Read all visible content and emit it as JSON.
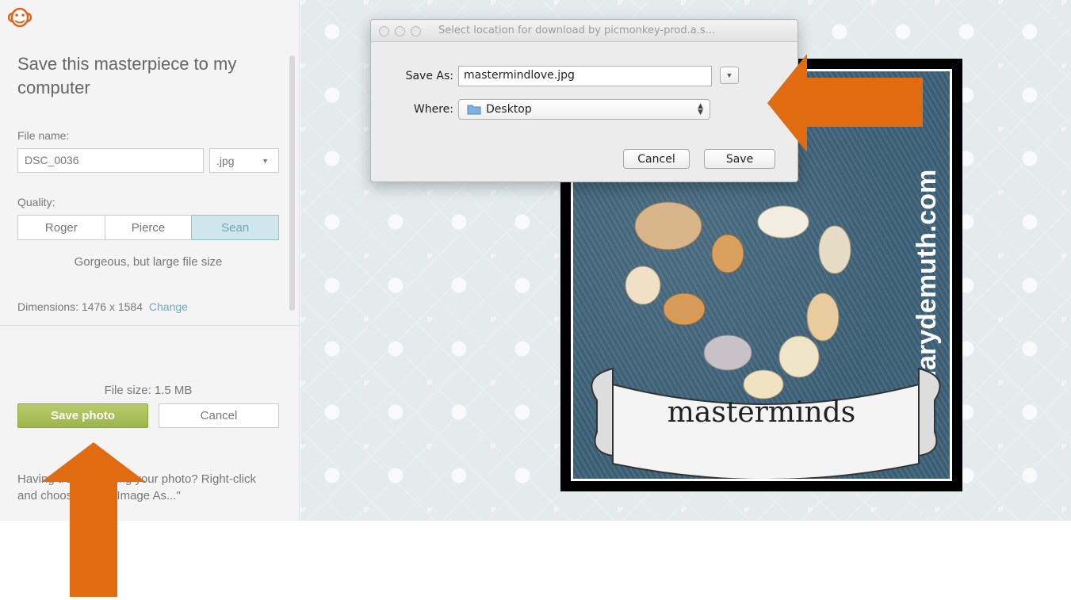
{
  "left_panel": {
    "logo_icon": "monkey-icon",
    "title": "Save this masterpiece to my computer",
    "file_name_label": "File name:",
    "file_name_value": "DSC_0036",
    "extension_value": ".jpg",
    "quality_label": "Quality:",
    "quality_options": [
      "Roger",
      "Pierce",
      "Sean"
    ],
    "quality_selected": "Sean",
    "quality_description": "Gorgeous, but large file size",
    "dimensions_label": "Dimensions:",
    "dimensions_value": "1476 x 1584",
    "change_link": "Change",
    "file_size": "File size: 1.5 MB",
    "save_button": "Save photo",
    "cancel_button": "Cancel",
    "help_text": "Having trouble saving your photo? Right-click and choose \"Save Image As...\"",
    "colors": {
      "save_green": "#a7bd55",
      "active_quality": "#cfe7ec",
      "link_blue": "#6aaec2"
    }
  },
  "dialog": {
    "title": "Select location for download by picmonkey-prod.a.s...",
    "save_as_label": "Save As:",
    "save_as_value": "mastermindlove.jpg",
    "where_label": "Where:",
    "where_value": "Desktop",
    "cancel_button": "Cancel",
    "save_button": "Save"
  },
  "canvas": {
    "watermark": "marydemuth.com",
    "banner_text": "masterminds"
  },
  "annotations": {
    "arrow_color": "#e06b10",
    "arrows": [
      "arrow-up-icon",
      "arrow-left-icon"
    ]
  }
}
